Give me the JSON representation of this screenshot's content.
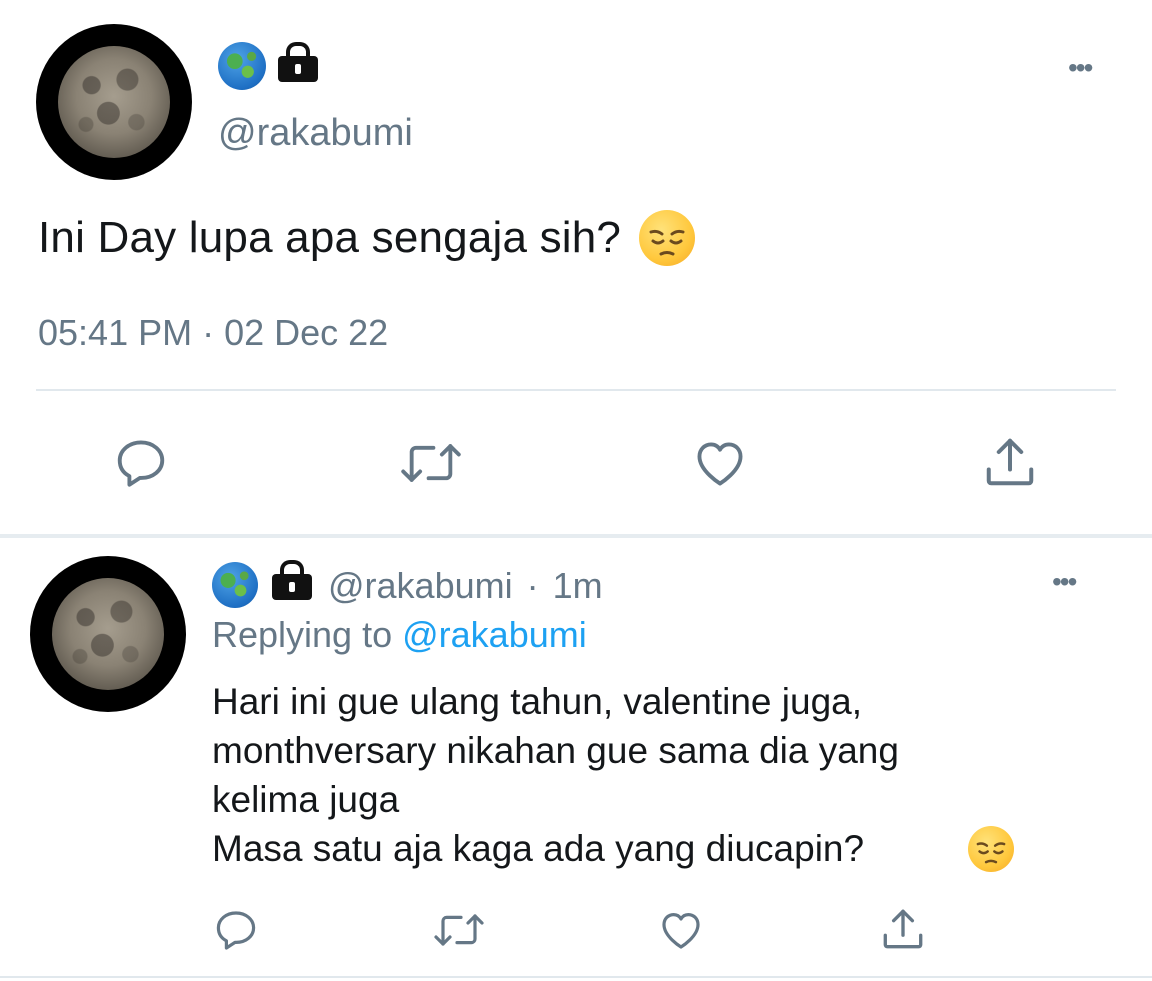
{
  "tweet": {
    "handle": "@rakabumi",
    "text": "Ini Day lupa apa sengaja sih?",
    "timestamp": "05:41 PM · 02 Dec 22",
    "more_label": "•••",
    "icons": [
      "globe-icon",
      "lock-icon",
      "pensive-face-emoji"
    ],
    "actions": [
      "reply-icon",
      "retweet-icon",
      "like-icon",
      "share-icon"
    ]
  },
  "reply": {
    "handle": "@rakabumi",
    "separator": "·",
    "age": "1m",
    "replying_prefix": "Replying to",
    "replying_to": "@rakabumi",
    "text": "Hari ini gue ulang tahun, valentine juga,\nmonthversary nikahan gue sama dia yang\nkelima juga\nMasa satu aja kaga ada yang diucapin?",
    "more_label": "•••",
    "actions": [
      "reply-icon",
      "retweet-icon",
      "like-icon",
      "share-icon"
    ]
  },
  "colors": {
    "text": "#14171a",
    "secondary": "#657786",
    "link": "#1da1f2",
    "divider": "#e1e8ed"
  }
}
